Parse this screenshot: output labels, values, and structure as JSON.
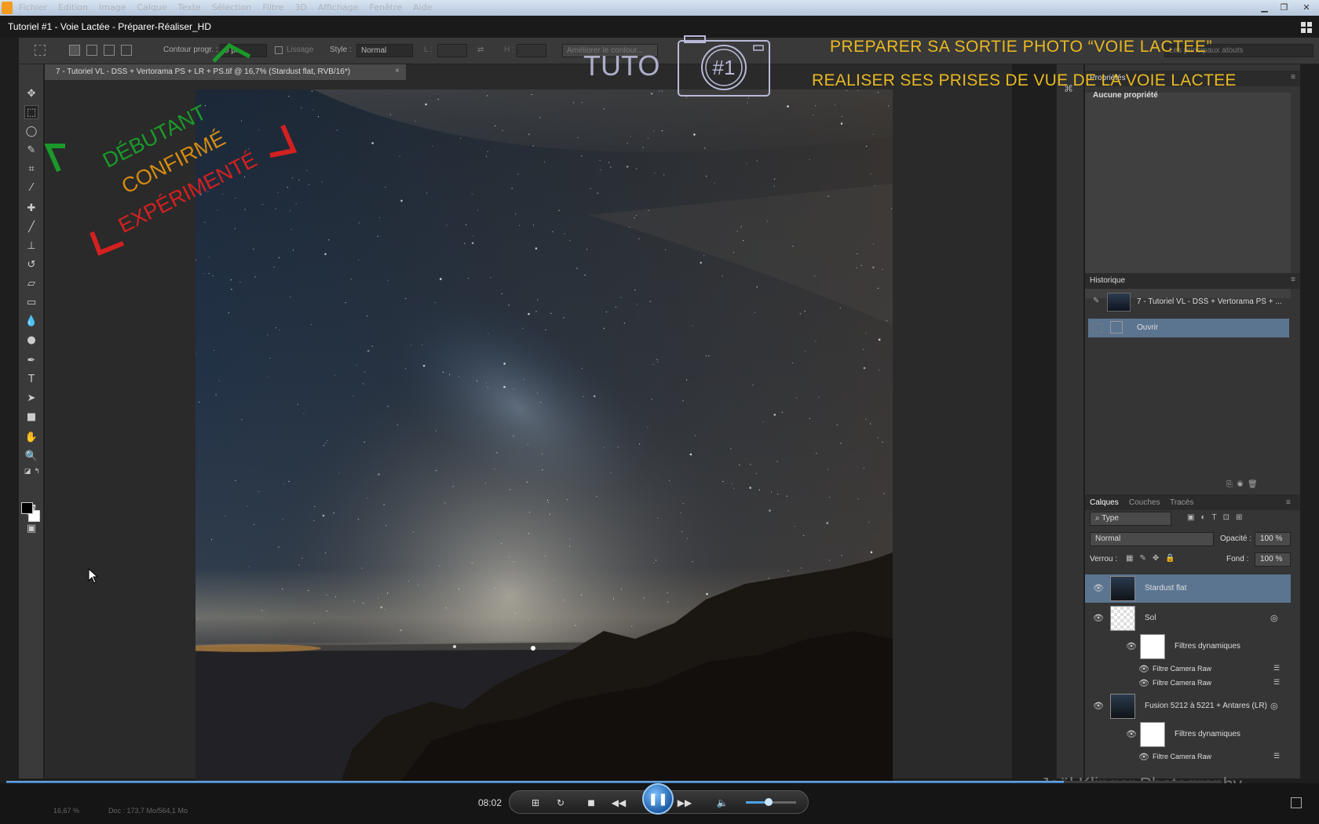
{
  "player": {
    "window_title": "Tutoriel #1 - Voie Lactée - Préparer-Réaliser_HD",
    "time": "08:02",
    "progress_fraction": 0.87,
    "volume_fraction": 0.45,
    "controls": [
      "windows-logo-icon",
      "repeat-icon",
      "stop-icon",
      "rewind-icon",
      "pause-icon",
      "forward-icon",
      "volume-icon"
    ]
  },
  "photoshop": {
    "menu": [
      "Fichier",
      "Edition",
      "Image",
      "Calque",
      "Texte",
      "Sélection",
      "Filtre",
      "3D",
      "Affichage",
      "Fenêtre",
      "Aide"
    ],
    "options_bar": {
      "contour_label": "Contour progr. :",
      "contour_value": "0 px",
      "lissage": "Lissage",
      "style_label": "Style :",
      "style_value": "Normal",
      "l_label": "L :",
      "h_label": "H :",
      "ameliorer": "Améliorer le contour...",
      "workspace": "Les principaux atouts"
    },
    "document_tab": "7 - Tutoriel VL - DSS + Vertorama PS + LR + PS.tif @ 16,7% (Stardust flat, RVB/16*)",
    "status": {
      "zoom": "16,67 %",
      "doc": "Doc : 173,7 Mo/564,1 Mo"
    },
    "properties": {
      "title": "Propriétés",
      "empty": "Aucune propriété"
    },
    "history": {
      "title": "Historique",
      "snapshot": "7 - Tutoriel VL - DSS + Vertorama PS + ...",
      "steps": [
        "Ouvrir"
      ]
    },
    "layers": {
      "tabs": [
        "Calques",
        "Couches",
        "Tracés"
      ],
      "filter": "Type",
      "blend": "Normal",
      "opacity_label": "Opacité :",
      "opacity": "100 %",
      "lock_label": "Verrou :",
      "fill_label": "Fond :",
      "fill": "100 %",
      "items": [
        {
          "name": "Stardust flat",
          "kind": "layer"
        },
        {
          "name": "Sol",
          "kind": "smart"
        },
        {
          "name": "Filtres dynamiques",
          "kind": "filters"
        },
        {
          "name": "Filtre Camera Raw",
          "kind": "filter"
        },
        {
          "name": "Filtre Camera Raw",
          "kind": "filter"
        },
        {
          "name": "Fusion 5212 à 5221 + Antares (LR)",
          "kind": "smart"
        },
        {
          "name": "Filtres dynamiques",
          "kind": "filters"
        },
        {
          "name": "Filtre Camera Raw",
          "kind": "filter"
        }
      ]
    }
  },
  "overlay": {
    "title_line1": "PREPARER SA SORTIE PHOTO “VOIE LACTEE”",
    "title_line2": "REALISER SES PRISES DE VUE DE LA VOIE LACTEE",
    "tuto": "TUTO",
    "episode": "#1",
    "levels": [
      {
        "label": "DÉBUTANT",
        "color": "#1a9a2a"
      },
      {
        "label": "CONFIRMÉ",
        "color": "#d48a12"
      },
      {
        "label": "EXPÉRIMENTÉ",
        "color": "#d42020"
      }
    ],
    "watermark": "Joël Klinger Photography"
  }
}
